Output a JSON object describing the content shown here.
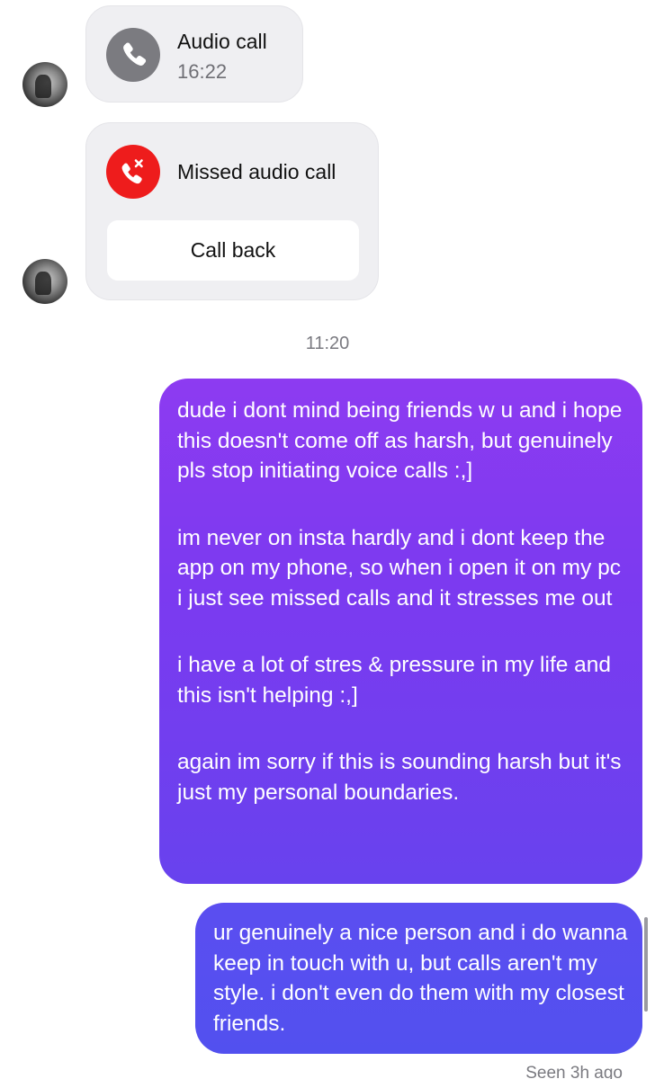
{
  "thread": {
    "audio_call": {
      "title": "Audio call",
      "time": "16:22",
      "icon": "phone-icon",
      "icon_color": "#7b7b80"
    },
    "missed_call": {
      "title": "Missed audio call",
      "icon": "missed-call-icon",
      "icon_color": "#ee1c1c",
      "action_label": "Call back"
    },
    "timestamp": "11:20",
    "messages": [
      {
        "paragraphs": [
          "dude i dont mind being friends w u and i hope this doesn't come off as harsh, but genuinely pls stop initiating voice calls :,]",
          "im never on insta hardly and i dont keep the app on my phone, so when i open it on my pc i just see missed calls and it stresses me out",
          "i have a lot of stres & pressure in my life and this isn't helping :,]",
          "again im sorry if this is sounding harsh but it's just my personal boundaries."
        ]
      },
      {
        "paragraphs": [
          "ur genuinely a nice person and i do wanna keep in touch with u, but calls aren't my style. i don't even do them with my closest friends."
        ]
      }
    ],
    "seen_status": "Seen 3h ago"
  },
  "colors": {
    "bubble_gradient_top": "#8d3bf1",
    "bubble_gradient_bottom": "#5250ef",
    "call_card_bg": "#efeff2"
  }
}
